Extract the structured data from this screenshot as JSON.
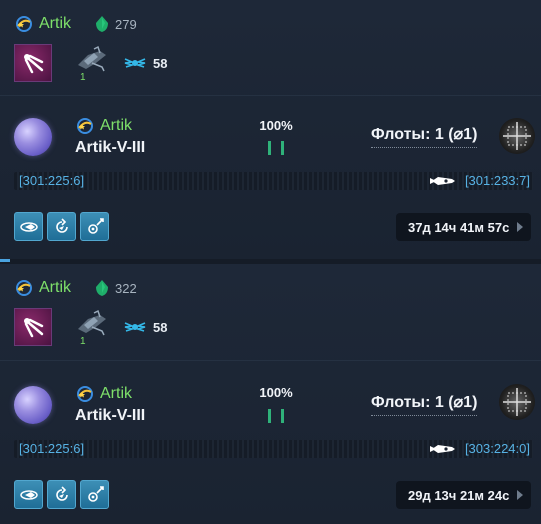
{
  "missions": [
    {
      "owner": "Artik",
      "resource_value": "279",
      "ship_count": "1",
      "power": "58",
      "target_owner": "Artik",
      "planet_name": "Artik-V-III",
      "percent": "100%",
      "fleets_label": "Флоты: 1 (⌀1)",
      "coord_from": "[301:225:6]",
      "coord_to": "[301:233:7]",
      "timer": "37д 14ч 41м 57с"
    },
    {
      "owner": "Artik",
      "resource_value": "322",
      "ship_count": "1",
      "power": "58",
      "target_owner": "Artik",
      "planet_name": "Artik-V-III",
      "percent": "100%",
      "fleets_label": "Флоты: 1 (⌀1)",
      "coord_from": "[301:225:6]",
      "coord_to": "[303:224:0]",
      "timer": "29д 13ч 21м 24с"
    }
  ],
  "icons": {
    "alliance": "alliance-swirl-icon",
    "resource": "green-crystal-icon",
    "mission": "mission-type-icon",
    "ship": "ship-icon",
    "power": "winged-power-icon",
    "route_ship": "route-ship-icon",
    "actions": [
      "orbit-action-icon",
      "return-action-icon",
      "fleet-settings-icon"
    ]
  },
  "colors": {
    "owner_name": "#7ee06a",
    "coordinates": "#57b2e4",
    "action_button": "#2d7ea8",
    "status_bars": "#2fb27a"
  }
}
